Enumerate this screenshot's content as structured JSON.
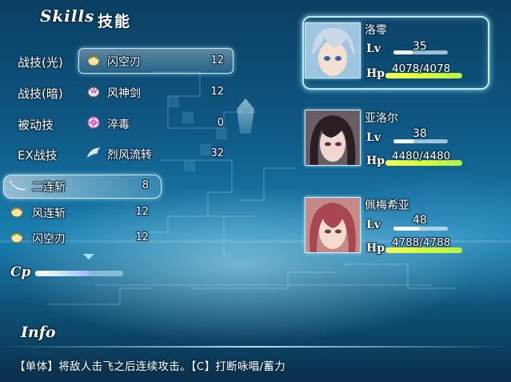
{
  "header": {
    "title_en": "Skills",
    "title_cn": "技能"
  },
  "categories": [
    {
      "label": "战技(光)",
      "skill": "闪空刃",
      "value": "12",
      "icon": "fist-icon",
      "selected": true
    },
    {
      "label": "战技(暗)",
      "skill": "风神剑",
      "value": "12",
      "icon": "claw-icon"
    },
    {
      "label": "被动技",
      "skill": "淬毒",
      "value": "0",
      "icon": "target-icon"
    },
    {
      "label": "EX战技",
      "skill": "烈风流转",
      "value": "32",
      "icon": "wing-icon"
    }
  ],
  "skill_list": [
    {
      "name": "二连斩",
      "value": "8",
      "icon": "slash-icon",
      "selected": true
    },
    {
      "name": "风连斩",
      "value": "12",
      "icon": "fist-icon"
    },
    {
      "name": "闪空刃",
      "value": "12",
      "icon": "fist-icon"
    }
  ],
  "cp": {
    "label": "Cp",
    "fill_fraction": 0.62
  },
  "info": {
    "label": "Info",
    "text": "【单体】将敌人击飞之后连续攻击。【C】打断咏唱/蓄力"
  },
  "party": [
    {
      "name": "洛零",
      "lv_label": "Lv",
      "level": "35",
      "lv_fraction": 0.35,
      "hp_label": "Hp",
      "hp": "4078/4078",
      "hp_fraction": 1.0,
      "hair": "#c9d7e6",
      "skin": "#f4e0d2",
      "eyes": "#3b5fa0",
      "selected": true
    },
    {
      "name": "亚洛尔",
      "lv_label": "Lv",
      "level": "38",
      "lv_fraction": 0.38,
      "hp_label": "Hp",
      "hp": "4480/4480",
      "hp_fraction": 1.0,
      "hair": "#2a1e22",
      "skin": "#efd9cc",
      "eyes": "#6a2a4a"
    },
    {
      "name": "佩梅希亚",
      "lv_label": "Lv",
      "level": "48",
      "lv_fraction": 0.48,
      "hp_label": "Hp",
      "hp": "4788/4788",
      "hp_fraction": 1.0,
      "hair": "#a8474f",
      "skin": "#f3dccf",
      "eyes": "#6b3c3a"
    }
  ]
}
